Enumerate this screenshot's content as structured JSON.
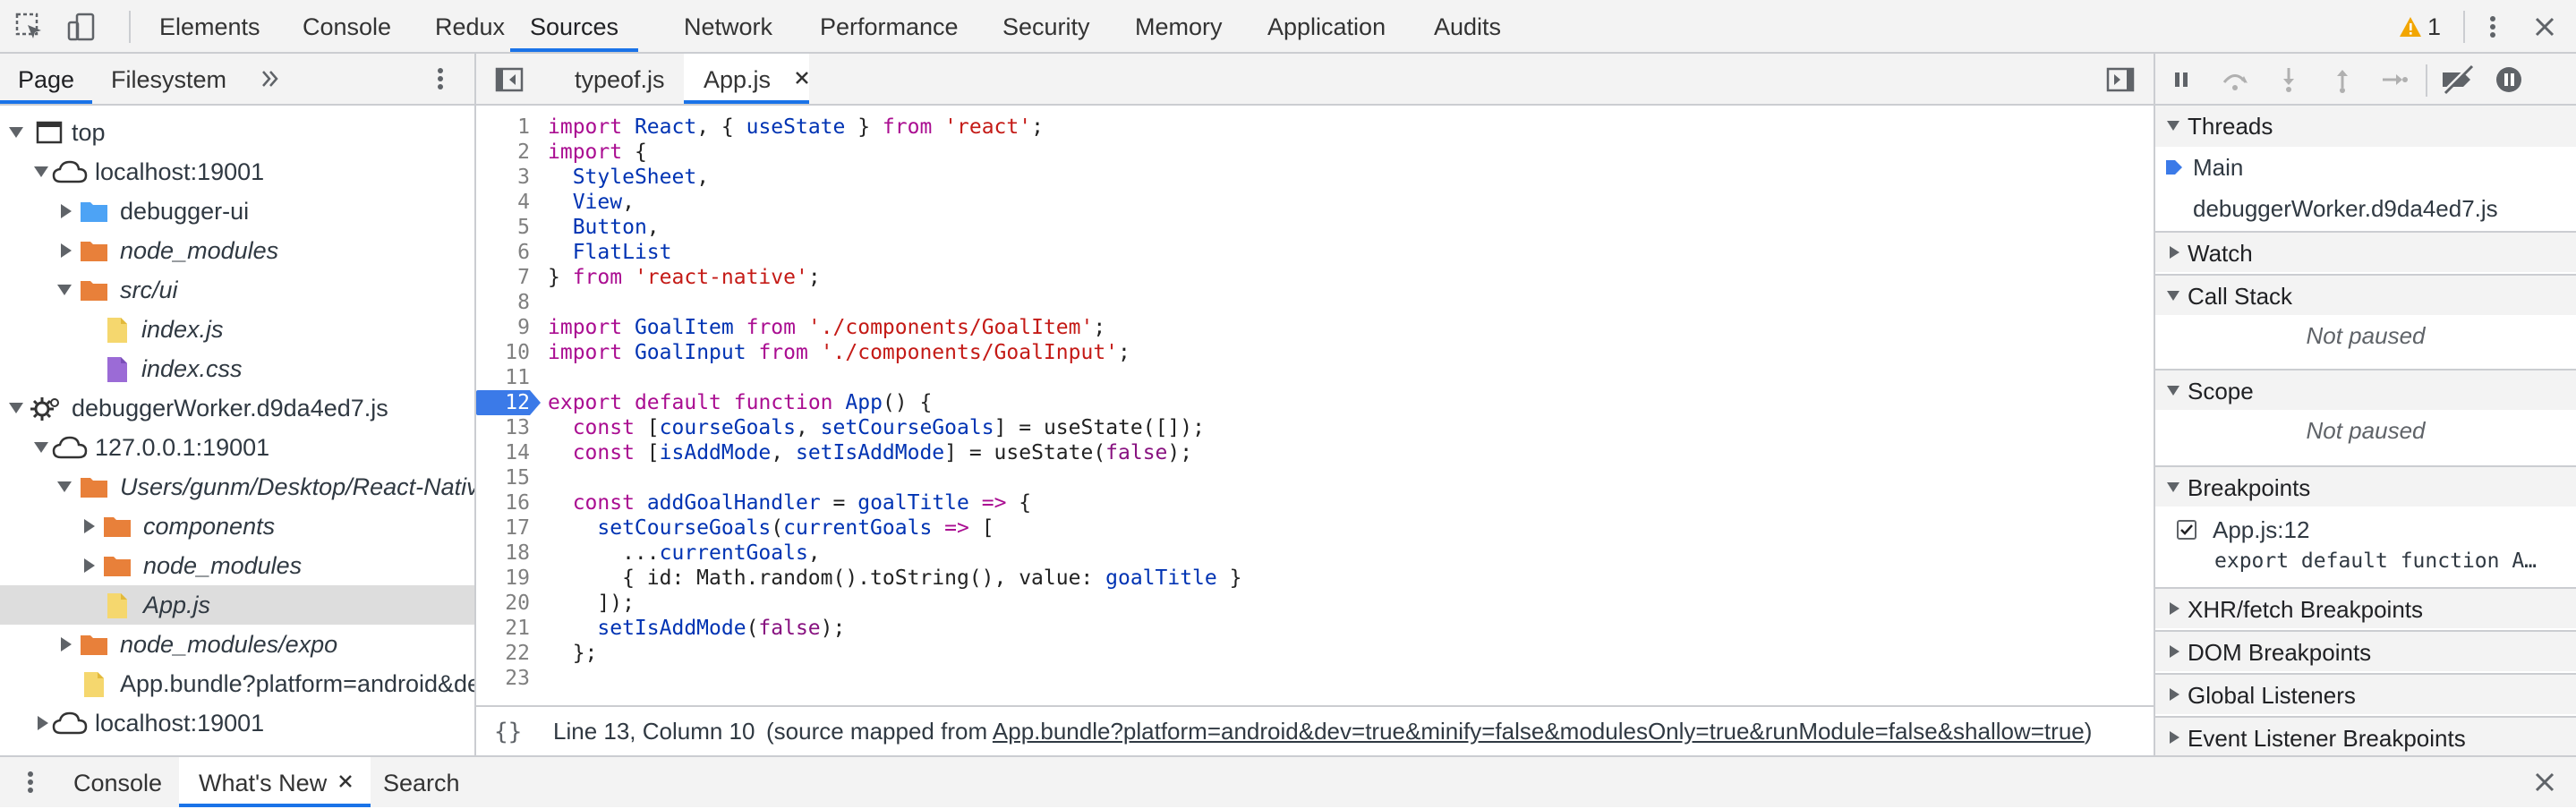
{
  "toolbar": {
    "tabs": [
      "Elements",
      "Console",
      "Redux",
      "Sources",
      "Network",
      "Performance",
      "Security",
      "Memory",
      "Application",
      "Audits"
    ],
    "active_tab": "Sources",
    "warning_count": "1",
    "accent_color": "#1a73e8",
    "warning_color": "#f2a600"
  },
  "navigator": {
    "tabs": [
      "Page",
      "Filesystem"
    ],
    "tree": [
      {
        "label": "top",
        "icon": "frame-icon"
      },
      {
        "label": "localhost:19001",
        "icon": "cloud-icon"
      },
      {
        "label": "debugger-ui",
        "icon": "folder-icon"
      },
      {
        "label": "node_modules",
        "icon": "folder-icon"
      },
      {
        "label": "src/ui",
        "icon": "folder-icon"
      },
      {
        "label": "index.js",
        "icon": "js-file-icon"
      },
      {
        "label": "index.css",
        "icon": "css-file-icon"
      },
      {
        "label": "debuggerWorker.d9da4ed7.js",
        "icon": "gear-icon"
      },
      {
        "label": "127.0.0.1:19001",
        "icon": "cloud-icon"
      },
      {
        "label": "Users/gunm/Desktop/React-Nativ",
        "icon": "folder-icon"
      },
      {
        "label": "components",
        "icon": "folder-icon"
      },
      {
        "label": "node_modules",
        "icon": "folder-icon"
      },
      {
        "label": "App.js",
        "icon": "js-file-icon"
      },
      {
        "label": "node_modules/expo",
        "icon": "folder-icon"
      },
      {
        "label": "App.bundle?platform=android&de",
        "icon": "js-file-icon"
      },
      {
        "label": "localhost:19001",
        "icon": "cloud-icon"
      }
    ]
  },
  "editor": {
    "tabs": [
      "typeof.js",
      "App.js"
    ],
    "active_tab": "App.js",
    "breakpoint_line": "12",
    "line_numbers": [
      "1",
      "2",
      "3",
      "4",
      "5",
      "6",
      "7",
      "8",
      "9",
      "10",
      "11",
      "12",
      "13",
      "14",
      "15",
      "16",
      "17",
      "18",
      "19",
      "20",
      "21",
      "22",
      "23"
    ],
    "status": {
      "position": "Line 13, Column 10",
      "mapped_prefix": "(source mapped from ",
      "mapped_link": "App.bundle?platform=android&dev=true&minify=false&modulesOnly=true&runModule=false&shallow=true",
      "mapped_suffix": ")"
    }
  },
  "sidebar": {
    "threads_title": "Threads",
    "threads": [
      "Main",
      "debuggerWorker.d9da4ed7.js"
    ],
    "watch_title": "Watch",
    "callstack_title": "Call Stack",
    "callstack_status": "Not paused",
    "scope_title": "Scope",
    "scope_status": "Not paused",
    "breakpoints_title": "Breakpoints",
    "breakpoint_location": "App.js:12",
    "breakpoint_code": "export default function A…",
    "other_sections": [
      "XHR/fetch Breakpoints",
      "DOM Breakpoints",
      "Global Listeners",
      "Event Listener Breakpoints"
    ]
  },
  "drawer": {
    "tabs": [
      "Console",
      "What's New",
      "Search"
    ],
    "active_tab": "What's New"
  }
}
